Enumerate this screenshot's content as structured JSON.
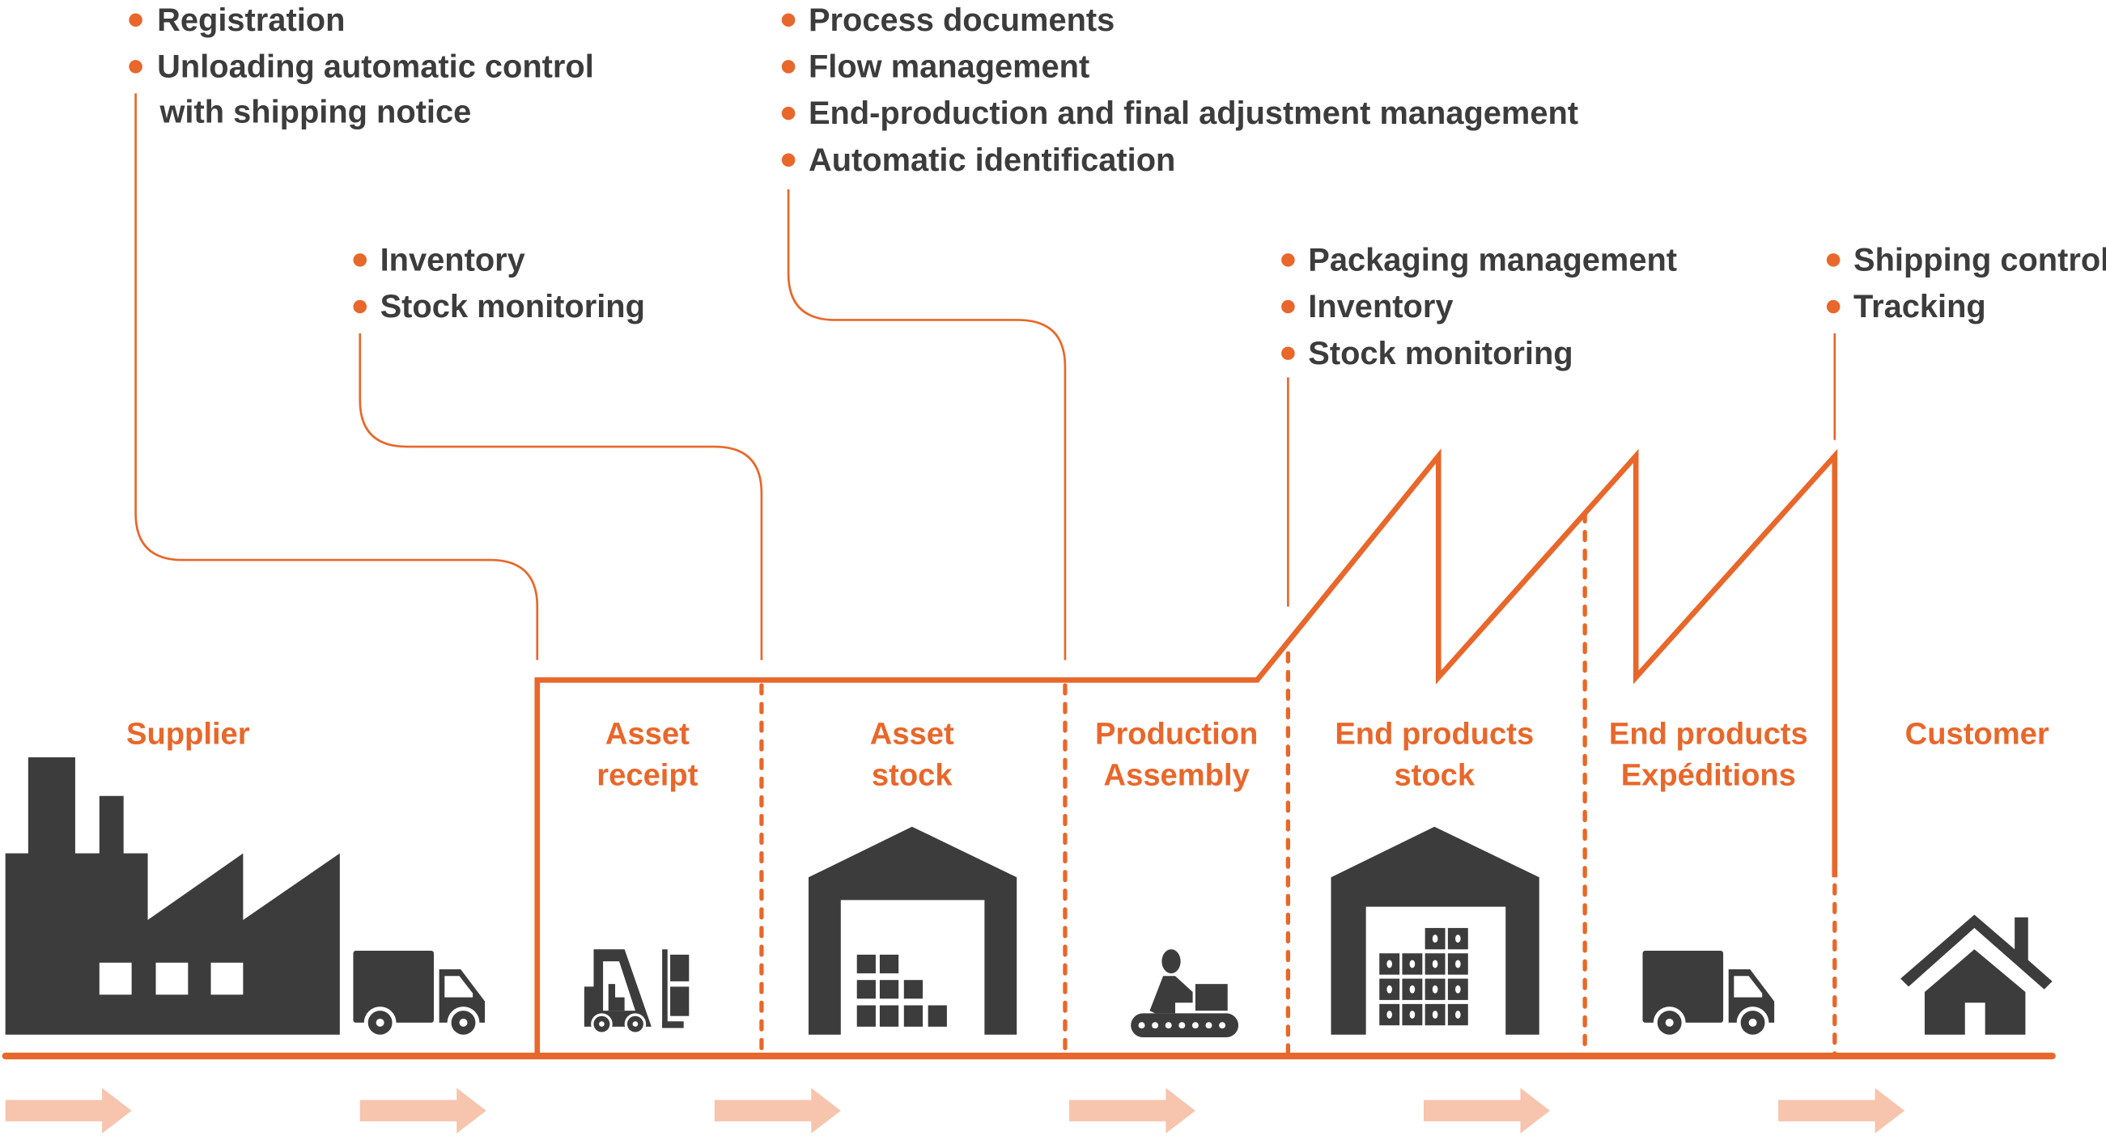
{
  "colors": {
    "accent": "#e8672a",
    "icon": "#3c3c3c",
    "text": "#3c3c3c",
    "flow_arrow": "#f7c4ad"
  },
  "feature_groups": [
    {
      "id": "receipt",
      "items": [
        "Registration",
        "Unloading automatic control",
        "with shipping notice"
      ]
    },
    {
      "id": "stock",
      "items": [
        "Inventory",
        "Stock monitoring"
      ]
    },
    {
      "id": "production",
      "items": [
        "Process documents",
        "Flow management",
        "End-production and final adjustment management",
        "Automatic identification"
      ]
    },
    {
      "id": "end-stock",
      "items": [
        "Packaging management",
        "Inventory",
        "Stock monitoring"
      ]
    },
    {
      "id": "shipping",
      "items": [
        "Shipping control",
        "Tracking"
      ]
    }
  ],
  "stages": [
    {
      "id": "supplier",
      "lines": [
        "Supplier"
      ],
      "icons": [
        "factory-icon",
        "truck-icon"
      ]
    },
    {
      "id": "asset-receipt",
      "lines": [
        "Asset",
        "receipt"
      ],
      "icons": [
        "forklift-icon"
      ]
    },
    {
      "id": "asset-stock",
      "lines": [
        "Asset",
        "stock"
      ],
      "icons": [
        "warehouse-icon"
      ]
    },
    {
      "id": "production-assembly",
      "lines": [
        "Production",
        "Assembly"
      ],
      "icons": [
        "conveyor-worker-icon"
      ]
    },
    {
      "id": "end-products-stock",
      "lines": [
        "End products",
        "stock"
      ],
      "icons": [
        "warehouse-full-icon"
      ]
    },
    {
      "id": "end-products-expeditions",
      "lines": [
        "End products",
        "Expéditions"
      ],
      "icons": [
        "truck-icon"
      ]
    },
    {
      "id": "customer",
      "lines": [
        "Customer"
      ],
      "icons": [
        "house-icon"
      ]
    }
  ],
  "flow_arrows": 6
}
